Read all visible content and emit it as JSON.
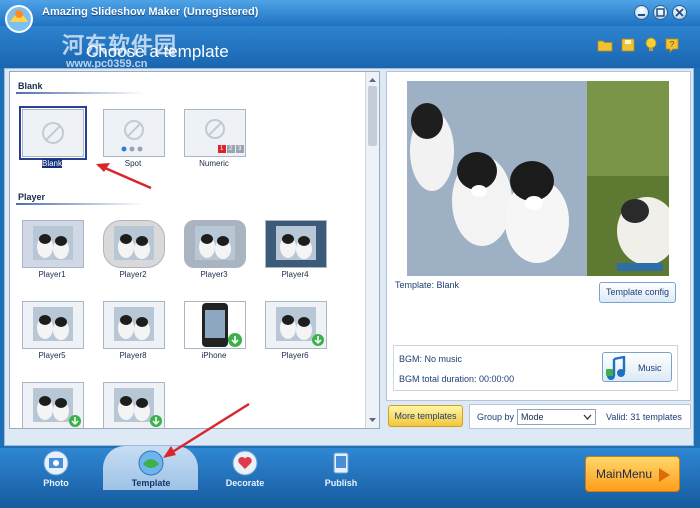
{
  "window": {
    "title": "Amazing Slideshow Maker (Unregistered)",
    "watermark": {
      "chinese": "河东软件园",
      "url": "www.pc0359.cn"
    }
  },
  "header": {
    "heading": "Choose a template"
  },
  "templates": {
    "sections": [
      {
        "title": "Blank",
        "items": [
          {
            "label": "Blank",
            "selected": true
          },
          {
            "label": "Spot"
          },
          {
            "label": "Numeric"
          }
        ]
      },
      {
        "title": "Player",
        "items": [
          {
            "label": "Player1"
          },
          {
            "label": "Player2"
          },
          {
            "label": "Player3"
          },
          {
            "label": "Player4"
          },
          {
            "label": "Player5"
          },
          {
            "label": "Player8"
          },
          {
            "label": "iPhone"
          },
          {
            "label": "Player6"
          },
          {
            "label": ""
          },
          {
            "label": ""
          }
        ]
      }
    ],
    "numeric_badges": [
      "1",
      "2",
      "3"
    ]
  },
  "preview": {
    "template_text": "Template:  Blank",
    "template_config_label": "Template config",
    "bgm_text": "BGM: No music",
    "bgm_duration_text": "BGM total duration: 00:00:00",
    "music_label": "Music"
  },
  "toolbar": {
    "more_templates_label": "More templates",
    "group_by_label": "Group by",
    "group_by_value": "Mode",
    "valid_text": "Valid: 31 templates"
  },
  "nav": {
    "tabs": [
      {
        "label": "Photo",
        "active": false
      },
      {
        "label": "Template",
        "active": true
      },
      {
        "label": "Decorate",
        "active": false
      },
      {
        "label": "Publish",
        "active": false
      }
    ],
    "main_menu_label": "MainMenu"
  },
  "colors": {
    "accent_blue": "#1e72c2",
    "selection_navy": "#16327a",
    "main_menu_orange": "#ff9d1a",
    "annotation_red": "#d9262c"
  }
}
